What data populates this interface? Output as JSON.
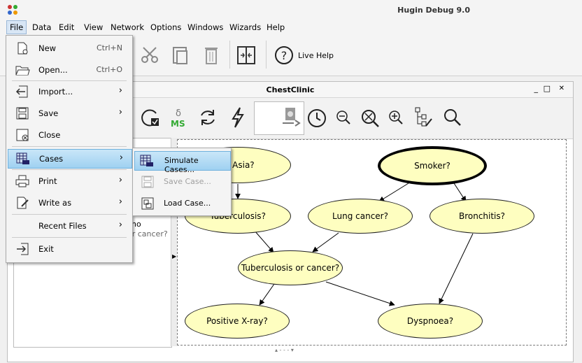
{
  "app": {
    "title": "Hugin Debug 9.0"
  },
  "menubar": [
    {
      "label": "File",
      "active": true
    },
    {
      "label": "Data"
    },
    {
      "label": "Edit"
    },
    {
      "label": "View"
    },
    {
      "label": "Network"
    },
    {
      "label": "Options"
    },
    {
      "label": "Windows"
    },
    {
      "label": "Wizards"
    },
    {
      "label": "Help"
    }
  ],
  "toolbar": {
    "live_help_label": "Live Help"
  },
  "network_window": {
    "title": "ChestClinic"
  },
  "file_menu": {
    "items": [
      {
        "label": "New",
        "shortcut": "Ctrl+N",
        "icon": "new-file-icon"
      },
      {
        "label": "Open...",
        "shortcut": "Ctrl+O",
        "icon": "folder-open-icon"
      },
      {
        "label": "Import...",
        "submenu": true,
        "icon": "import-icon"
      },
      {
        "label": "Save",
        "submenu": true,
        "icon": "save-icon"
      },
      {
        "label": "Close",
        "icon": "close-file-icon"
      },
      {
        "label": "Cases",
        "submenu": true,
        "highlighted": true,
        "icon": "cases-icon"
      },
      {
        "label": "Print",
        "submenu": true,
        "icon": "printer-icon"
      },
      {
        "label": "Write as",
        "submenu": true,
        "icon": "write-as-icon"
      },
      {
        "label": "Recent Files",
        "submenu": true
      },
      {
        "label": "Exit",
        "icon": "exit-icon"
      }
    ]
  },
  "cases_submenu": {
    "items": [
      {
        "label": "Simulate Cases...",
        "highlighted": true,
        "enabled": true
      },
      {
        "label": "Save Case...",
        "enabled": false
      },
      {
        "label": "Load Case...",
        "enabled": true
      }
    ]
  },
  "nodes": [
    {
      "id": "asia",
      "label": "to Asia?"
    },
    {
      "id": "smoker",
      "label": "Smoker?"
    },
    {
      "id": "tuberculosis",
      "label": "Tuberculosis?"
    },
    {
      "id": "lung_cancer",
      "label": "Lung cancer?"
    },
    {
      "id": "bronchitis",
      "label": "Bronchitis?"
    },
    {
      "id": "tub_or_cancer",
      "label": "Tuberculosis or cancer?"
    },
    {
      "id": "xray",
      "label": "Positive X-ray?"
    },
    {
      "id": "dyspnoea",
      "label": "Dyspnoea?"
    }
  ],
  "left_panel": {
    "fragment": "no",
    "fragment2": "or cancer?"
  },
  "window_controls": {
    "minimize": "_",
    "maximize": "□",
    "close": "✕"
  },
  "colors": {
    "node_fill": "#fefec0",
    "highlight": "#9fd1f1"
  }
}
